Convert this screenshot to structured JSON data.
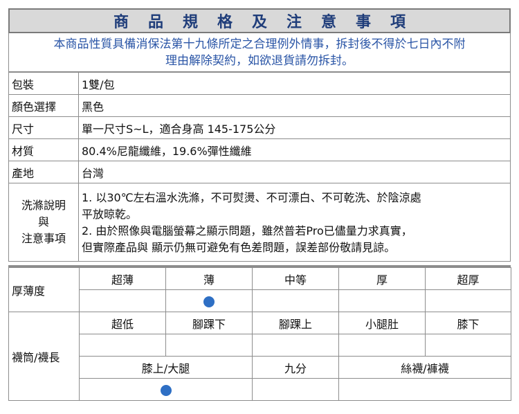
{
  "title": "商品規格及注意事項",
  "notice": {
    "line1": "本商品性質具備消保法第十九條所定之合理例外情事，拆封後不得於七日內不附",
    "line2": "理由解除契約，如欲退貨請勿拆封。"
  },
  "specs": [
    {
      "label": "包裝",
      "value": "1雙/包"
    },
    {
      "label": "顏色選擇",
      "value": "黑色"
    },
    {
      "label": "尺寸",
      "value": "單一尺寸S~L，適合身高 145-175公分"
    },
    {
      "label": "材質",
      "value": "80.4%尼龍纖維，19.6%彈性纖維"
    },
    {
      "label": "產地",
      "value": "台灣"
    }
  ],
  "wash": {
    "label_line1": "洗滌說明",
    "label_line2": "與",
    "label_line3": "注意事項",
    "line1": "1. 以30℃左右溫水洗滌，不可熨燙、不可漂白、不可乾洗、於陰涼處",
    "line2": "平放晾乾。",
    "line3": "2. 由於照像與電腦螢幕之顯示問題，雖然普若Pro已儘量力求真實，",
    "line4": "但實際產品與 顯示仍無可避免有色差問題，誤差部份敬請見諒。"
  },
  "thickness": {
    "label": "厚薄度",
    "options": [
      "超薄",
      "薄",
      "中等",
      "厚",
      "超厚"
    ],
    "selected_index": 1
  },
  "length": {
    "label": "襪筒/襪長",
    "options_row1": [
      "超低",
      "腳踝下",
      "腳踝上",
      "小腿肚",
      "膝下"
    ],
    "options_row2": [
      "膝上/大腿",
      "九分",
      "絲襪/褲襪"
    ],
    "selected_row2_index": 0
  },
  "colors": {
    "title": "#1f3d7a",
    "notice": "#2a55a6",
    "dot": "#2e6fc4",
    "border": "#8c8c8c"
  }
}
